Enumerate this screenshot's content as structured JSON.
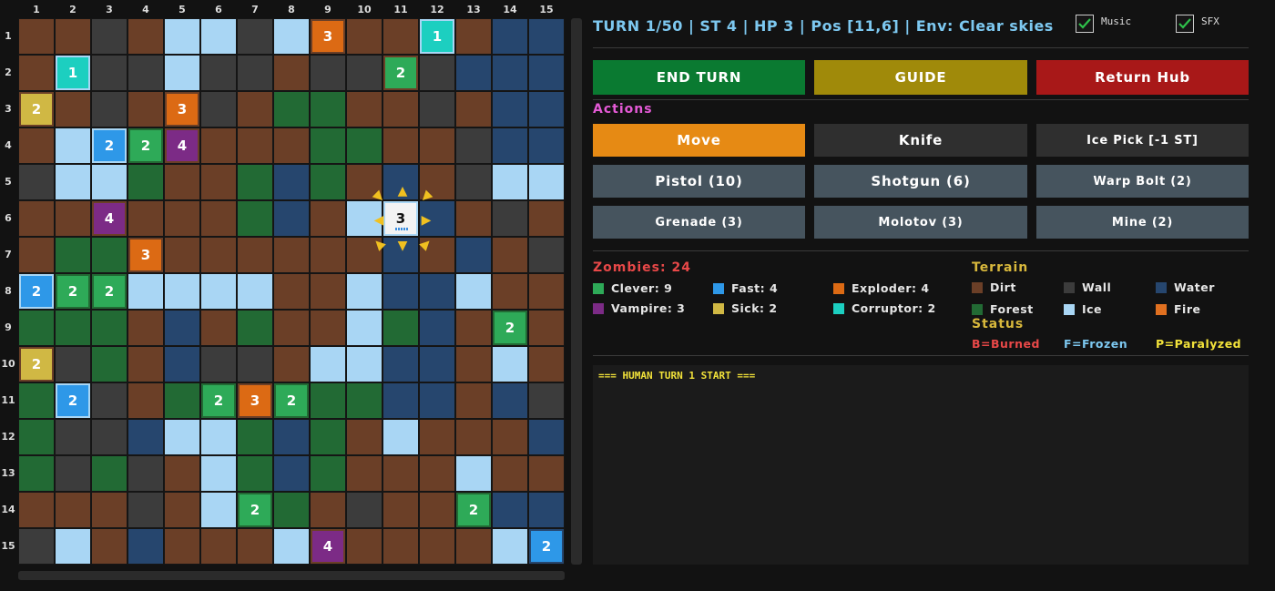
{
  "board": {
    "columns": [
      "1",
      "2",
      "3",
      "4",
      "5",
      "6",
      "7",
      "8",
      "9",
      "10",
      "11",
      "12",
      "13",
      "14",
      "15"
    ],
    "rows": [
      "1",
      "2",
      "3",
      "4",
      "5",
      "6",
      "7",
      "8",
      "9",
      "10",
      "11",
      "12",
      "13",
      "14",
      "15"
    ],
    "terrain": [
      "DDWDIIWIDDDIDAA",
      "DIWWIWWDWWDWAAA",
      "DDWDDWDFFDDWDAA",
      "DIIFDDDDFFDDWAA",
      "WIIFDDFAFDADWII",
      "DDDDDDFADIIADWD",
      "DFFDDDDDDDADADW",
      "IFFIIIIDDIAAIDD",
      "FFFDADFDDIFADFD",
      "DWFDAWWDIIAADID",
      "FIWDFFDFFFAADAW",
      "FWWAIIFAFDIDDDA",
      "FWFWDIFAFDDDIDD",
      "DDDWDIFFDWDDFAA",
      "WIDADDDIDDDDDIA"
    ],
    "zombies": [
      {
        "r": 1,
        "c": 9,
        "type": "exploder",
        "label": "3"
      },
      {
        "r": 1,
        "c": 12,
        "type": "corruptor",
        "label": "1"
      },
      {
        "r": 2,
        "c": 2,
        "type": "corruptor",
        "label": "1"
      },
      {
        "r": 2,
        "c": 11,
        "type": "clever",
        "label": "2"
      },
      {
        "r": 3,
        "c": 1,
        "type": "sick",
        "label": "2"
      },
      {
        "r": 3,
        "c": 5,
        "type": "exploder",
        "label": "3"
      },
      {
        "r": 4,
        "c": 3,
        "type": "fast",
        "label": "2"
      },
      {
        "r": 4,
        "c": 4,
        "type": "clever",
        "label": "2"
      },
      {
        "r": 4,
        "c": 5,
        "type": "vampire",
        "label": "4"
      },
      {
        "r": 6,
        "c": 3,
        "type": "vampire",
        "label": "4"
      },
      {
        "r": 7,
        "c": 4,
        "type": "exploder",
        "label": "3"
      },
      {
        "r": 8,
        "c": 1,
        "type": "fast",
        "label": "2"
      },
      {
        "r": 8,
        "c": 2,
        "type": "clever",
        "label": "2"
      },
      {
        "r": 8,
        "c": 3,
        "type": "clever",
        "label": "2"
      },
      {
        "r": 9,
        "c": 14,
        "type": "clever",
        "label": "2"
      },
      {
        "r": 10,
        "c": 1,
        "type": "sick",
        "label": "2"
      },
      {
        "r": 11,
        "c": 2,
        "type": "fast",
        "label": "2"
      },
      {
        "r": 11,
        "c": 6,
        "type": "clever",
        "label": "2"
      },
      {
        "r": 11,
        "c": 7,
        "type": "exploder",
        "label": "3"
      },
      {
        "r": 11,
        "c": 8,
        "type": "clever",
        "label": "2"
      },
      {
        "r": 14,
        "c": 7,
        "type": "clever",
        "label": "2"
      },
      {
        "r": 14,
        "c": 13,
        "type": "clever",
        "label": "2"
      },
      {
        "r": 15,
        "c": 9,
        "type": "vampire",
        "label": "4"
      },
      {
        "r": 15,
        "c": 15,
        "type": "fast",
        "label": "2"
      }
    ],
    "player": {
      "r": 6,
      "c": 11,
      "label": "3"
    },
    "move_arrows": [
      {
        "dir": "up-left",
        "glyph": "▼",
        "rot": -45
      },
      {
        "dir": "up",
        "glyph": "▲",
        "rot": 0
      },
      {
        "dir": "up-right",
        "glyph": "▼",
        "rot": 45
      },
      {
        "dir": "left",
        "glyph": "◀",
        "rot": 0
      },
      {
        "dir": "right",
        "glyph": "▶",
        "rot": 0
      },
      {
        "dir": "down-left",
        "glyph": "▲",
        "rot": -45
      },
      {
        "dir": "down",
        "glyph": "▼",
        "rot": 0
      },
      {
        "dir": "down-right",
        "glyph": "▲",
        "rot": 45
      }
    ]
  },
  "status_line": "TURN 1/50 | ST 4 | HP 3 | Pos [11,6] | Env: Clear skies",
  "toggles": {
    "music": {
      "label": "Music",
      "checked": true
    },
    "sfx": {
      "label": "SFX",
      "checked": true
    }
  },
  "top_buttons": {
    "end_turn": "END TURN",
    "guide": "GUIDE",
    "return_hub": "Return Hub"
  },
  "actions": {
    "title": "Actions",
    "move": "Move",
    "knife": "Knife",
    "ice_pick": "Ice Pick [-1 ST]",
    "pistol": "Pistol (10)",
    "shotgun": "Shotgun (6)",
    "warp_bolt": "Warp Bolt (2)",
    "grenade": "Grenade (3)",
    "molotov": "Molotov (3)",
    "mine": "Mine (2)"
  },
  "zombies_legend": {
    "title": "Zombies: 24",
    "clever": "Clever: 9",
    "fast": "Fast: 4",
    "exploder": "Exploder: 4",
    "vampire": "Vampire: 3",
    "sick": "Sick: 2",
    "corruptor": "Corruptor: 2"
  },
  "terrain_legend": {
    "title": "Terrain",
    "dirt": "Dirt",
    "wall": "Wall",
    "water": "Water",
    "forest": "Forest",
    "ice": "Ice",
    "fire": "Fire"
  },
  "status_legend": {
    "title": "Status",
    "burned": "B=Burned",
    "frozen": "F=Frozen",
    "paralyzed": "P=Paralyzed"
  },
  "log": [
    "=== HUMAN TURN 1 START ==="
  ],
  "colors": {
    "dirt": "#6b3f27",
    "wall": "#3c3c3c",
    "water": "#26466e",
    "forest": "#226a34",
    "ice": "#a9d6f4",
    "fire": "#e07020",
    "clever": "#2eaa58",
    "fast": "#2e98e8",
    "exploder": "#dc6a14",
    "vampire": "#7c2b86",
    "sick": "#d0b844",
    "corruptor": "#1ccfc0",
    "accent_blue": "#7dc8f0",
    "end_turn": "#0a7a31",
    "guide": "#a08a0a",
    "return_hub": "#a81818",
    "move": "#e68a14",
    "melee": "#2f2f2f",
    "ranged": "#46545e"
  }
}
